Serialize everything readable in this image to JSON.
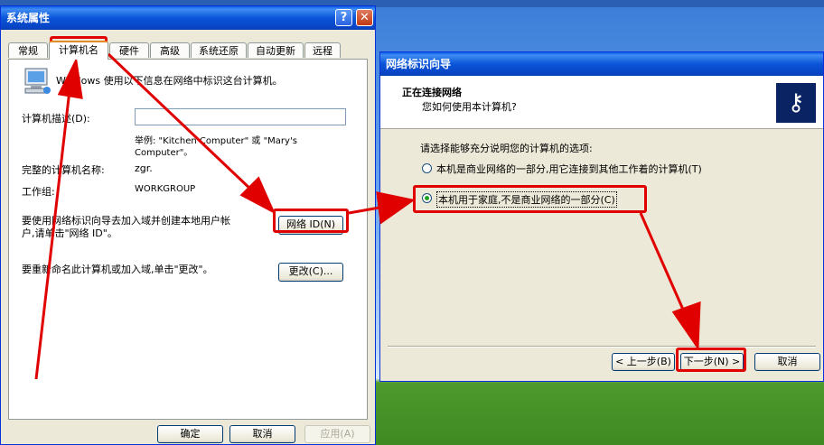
{
  "system_props": {
    "title": "系统属性",
    "help_glyph": "?",
    "close_glyph": "✕",
    "tabs": [
      "常规",
      "计算机名",
      "硬件",
      "高级",
      "系统还原",
      "自动更新",
      "远程"
    ],
    "intro": "Windows 使用以下信息在网络中标识这台计算机。",
    "desc_label": "计算机描述(D):",
    "desc_value": "",
    "example_line1": "举例: \"Kitchen Computer\" 或 \"Mary's",
    "example_line2": "Computer\"。",
    "fullname_label": "完整的计算机名称:",
    "fullname_value": "zgr.",
    "workgroup_label": "工作组:",
    "workgroup_value": "WORKGROUP",
    "network_id_text1": "要使用网络标识向导去加入域并创建本地用户帐",
    "network_id_text2": "户,请单击\"网络 ID\"。",
    "network_id_button": "网络 ID(N)",
    "rename_text": "要重新命名此计算机或加入域,单击\"更改\"。",
    "change_button": "更改(C)...",
    "ok_button": "确定",
    "cancel_button": "取消",
    "apply_button": "应用(A)"
  },
  "wizard": {
    "title": "网络标识向导",
    "header_title": "正在连接网络",
    "header_subtitle": "您如何使用本计算机?",
    "prompt": "请选择能够充分说明您的计算机的选项:",
    "option_business": "本机是商业网络的一部分,用它连接到其他工作着的计算机(T)",
    "option_home": "本机用于家庭,不是商业网络的一部分(C)",
    "selected_option": "home",
    "back_button": "< 上一步(B)",
    "next_button": "下一步(N) >",
    "cancel_button": "取消",
    "key_icon_glyph": "⚷"
  },
  "colors": {
    "annotation_red": "#e00000",
    "xp_title_blue": "#0a55d8",
    "dialog_bg": "#ece9d8"
  }
}
